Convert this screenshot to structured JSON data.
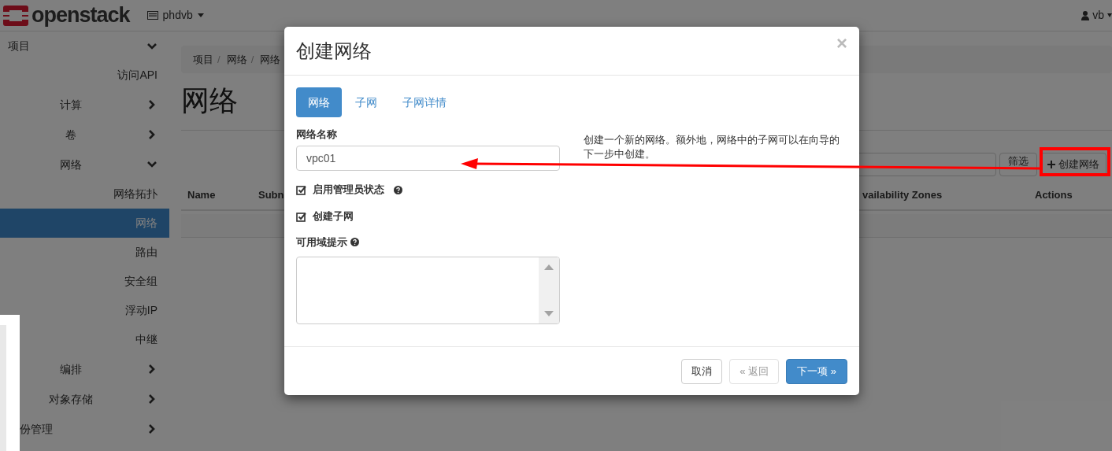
{
  "topbar": {
    "logo": "openstack",
    "project": "phdvb",
    "user": "vb"
  },
  "sidebar": {
    "items": [
      {
        "label": "项目",
        "kind": "section",
        "expanded": true,
        "children": [
          {
            "label": "访问API",
            "kind": "link",
            "selected": false
          },
          {
            "label": "计算",
            "kind": "group",
            "expanded": false
          },
          {
            "label": "卷",
            "kind": "group",
            "expanded": false
          },
          {
            "label": "网络",
            "kind": "group",
            "expanded": true,
            "children": [
              {
                "label": "网络拓扑",
                "kind": "link",
                "selected": false
              },
              {
                "label": "网络",
                "kind": "link",
                "selected": true
              },
              {
                "label": "路由",
                "kind": "link",
                "selected": false
              },
              {
                "label": "安全组",
                "kind": "link",
                "selected": false
              },
              {
                "label": "浮动IP",
                "kind": "link",
                "selected": false
              },
              {
                "label": "中继",
                "kind": "link",
                "selected": false
              }
            ]
          },
          {
            "label": "编排",
            "kind": "group",
            "expanded": false
          },
          {
            "label": "对象存储",
            "kind": "group",
            "expanded": false
          }
        ]
      },
      {
        "label": "份管理",
        "kind": "cut-group",
        "expanded": false
      }
    ]
  },
  "page": {
    "breadcrumb": {
      "separator": "/",
      "items": [
        "项目",
        "网络",
        "网络"
      ]
    },
    "title": "网络",
    "filter_button": "筛选",
    "create_button": "创建网络",
    "table": {
      "columns": [
        "Name",
        "Subn",
        "vailability Zones",
        "Actions"
      ]
    }
  },
  "modal": {
    "title": "创建网络",
    "close": "×",
    "tabs": [
      {
        "label": "网络",
        "selected": true
      },
      {
        "label": "子网",
        "selected": false
      },
      {
        "label": "子网详情",
        "selected": false
      }
    ],
    "name_label": "网络名称",
    "name_value": "vpc01",
    "checkboxes": [
      {
        "label": "启用管理员状态",
        "checked": true,
        "help": true
      },
      {
        "label": "创建子网",
        "checked": true,
        "help": false
      }
    ],
    "az_label": "可用域提示",
    "help_text": "创建一个新的网络。额外地，网络中的子网可以在向导的下一步中创建。",
    "buttons": [
      {
        "label": "取消",
        "kind": "default",
        "disabled": false
      },
      {
        "label": "« 返回",
        "kind": "default",
        "disabled": true
      },
      {
        "label": "下一项 »",
        "kind": "primary",
        "disabled": false
      }
    ]
  }
}
